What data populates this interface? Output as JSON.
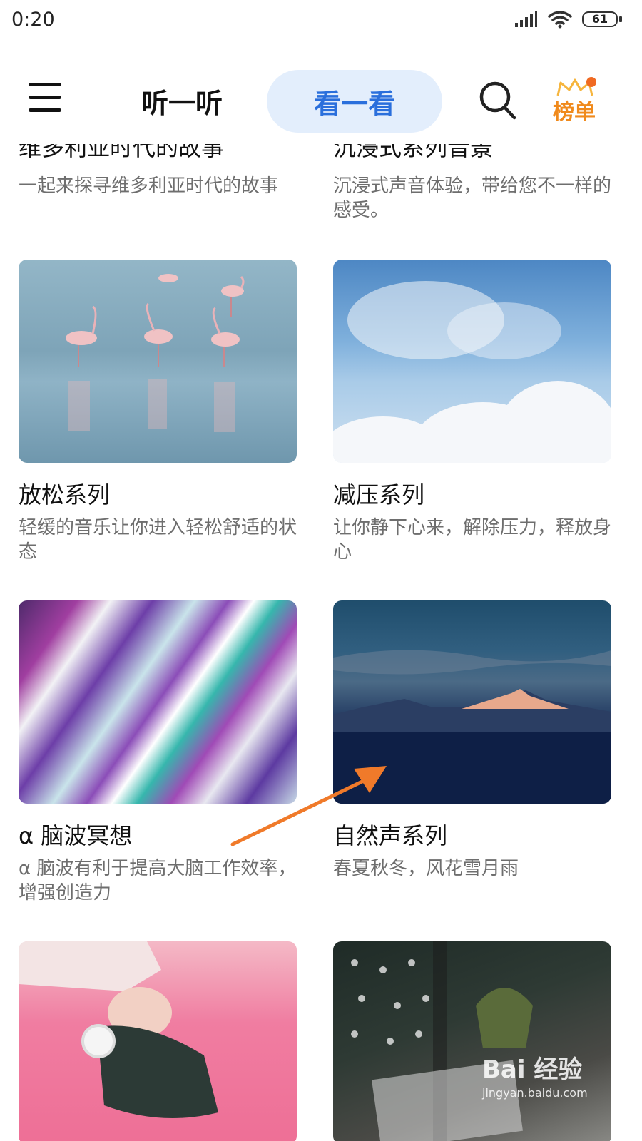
{
  "status_bar": {
    "time": "0:20",
    "battery": "61"
  },
  "nav": {
    "tab_listen": "听一听",
    "tab_watch": "看一看",
    "rank_label": "榜单"
  },
  "top_partial": {
    "left": {
      "title": "维多利亚时代的故事",
      "desc": "一起来探寻维多利亚时代的故事"
    },
    "right": {
      "title": "沉浸式系列音景",
      "desc": "沉浸式声音体验，带给您不一样的感受。"
    }
  },
  "cards": [
    {
      "title": "放松系列",
      "desc": "轻缓的音乐让你进入轻松舒适的状态"
    },
    {
      "title": "减压系列",
      "desc": "让你静下心来，解除压力，释放身心"
    },
    {
      "title": "α 脑波冥想",
      "desc": "α 脑波有利于提高大脑工作效率，增强创造力"
    },
    {
      "title": "自然声系列",
      "desc": "春夏秋冬，风花雪月雨"
    }
  ],
  "watermark": {
    "main": "Bai 经验",
    "url": "jingyan.baidu.com"
  },
  "colors": {
    "accent": "#2a6fdc",
    "tab_bg": "#e3eefc",
    "rank": "#f08a1c",
    "arrow": "#f07a2a"
  }
}
